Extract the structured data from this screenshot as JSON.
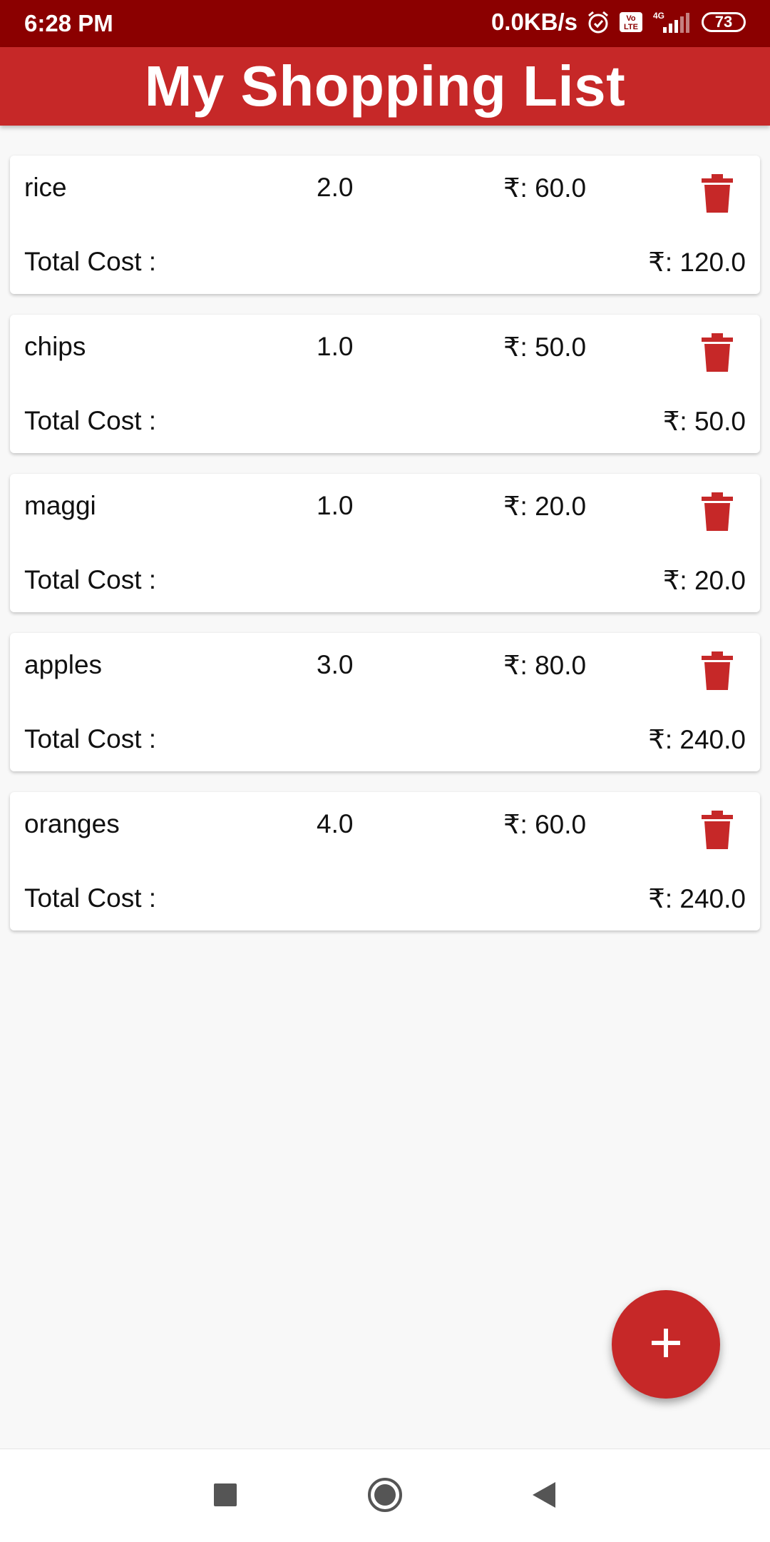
{
  "status_bar": {
    "time": "6:28 PM",
    "net_speed": "0.0KB/s",
    "volte": "Vo LTE",
    "network": "4G",
    "battery": "73"
  },
  "app": {
    "title": "My Shopping List"
  },
  "items": [
    {
      "name": "rice",
      "qty": "2.0",
      "price": "₹: 60.0",
      "total_label": "Total Cost :",
      "total": "₹: 120.0"
    },
    {
      "name": "chips",
      "qty": "1.0",
      "price": "₹: 50.0",
      "total_label": "Total Cost :",
      "total": "₹: 50.0"
    },
    {
      "name": "maggi",
      "qty": "1.0",
      "price": "₹: 20.0",
      "total_label": "Total Cost :",
      "total": "₹: 20.0"
    },
    {
      "name": "apples",
      "qty": "3.0",
      "price": "₹: 80.0",
      "total_label": "Total Cost :",
      "total": "₹: 240.0"
    },
    {
      "name": "oranges",
      "qty": "4.0",
      "price": "₹: 60.0",
      "total_label": "Total Cost :",
      "total": "₹: 240.0"
    }
  ],
  "icons": {
    "delete": "trash-icon",
    "fab": "plus-icon",
    "nav": [
      "recents-square-icon",
      "home-circle-icon",
      "back-triangle-icon"
    ]
  },
  "colors": {
    "status_bar": "#8b0000",
    "primary": "#c62828",
    "background": "#f8f8f8"
  }
}
